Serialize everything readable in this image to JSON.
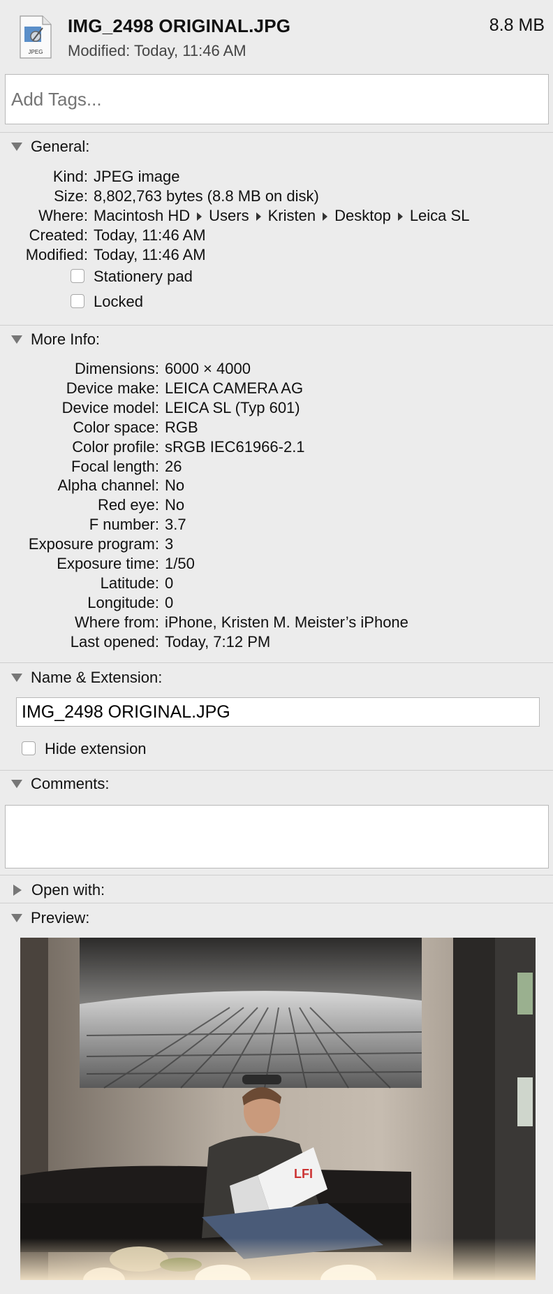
{
  "header": {
    "file_name": "IMG_2498 ORIGINAL.JPG",
    "file_size": "8.8 MB",
    "modified": "Modified: Today, 11:46 AM",
    "icon_label": "JPEG"
  },
  "tags": {
    "placeholder": "Add Tags..."
  },
  "general": {
    "title": "General:",
    "rows": [
      {
        "label": "Kind:",
        "value": "JPEG image"
      },
      {
        "label": "Size:",
        "value": "8,802,763 bytes (8.8 MB on disk)"
      },
      {
        "label": "Created:",
        "value": "Today, 11:46 AM"
      },
      {
        "label": "Modified:",
        "value": "Today, 11:46 AM"
      }
    ],
    "where_label": "Where:",
    "where_path": [
      "Macintosh HD",
      "Users",
      "Kristen",
      "Desktop",
      "Leica SL"
    ],
    "stationery_label": "Stationery pad",
    "locked_label": "Locked"
  },
  "more_info": {
    "title": "More Info:",
    "rows": [
      {
        "label": "Dimensions:",
        "value": "6000 × 4000"
      },
      {
        "label": "Device make:",
        "value": "LEICA CAMERA AG"
      },
      {
        "label": "Device model:",
        "value": "LEICA SL (Typ 601)"
      },
      {
        "label": "Color space:",
        "value": "RGB"
      },
      {
        "label": "Color profile:",
        "value": "sRGB IEC61966-2.1"
      },
      {
        "label": "Focal length:",
        "value": "26"
      },
      {
        "label": "Alpha channel:",
        "value": "No"
      },
      {
        "label": "Red eye:",
        "value": "No"
      },
      {
        "label": "F number:",
        "value": "3.7"
      },
      {
        "label": "Exposure program:",
        "value": "3"
      },
      {
        "label": "Exposure time:",
        "value": "1/50"
      },
      {
        "label": "Latitude:",
        "value": "0"
      },
      {
        "label": "Longitude:",
        "value": "0"
      },
      {
        "label": "Where from:",
        "value": "iPhone, Kristen M. Meister’s iPhone"
      },
      {
        "label": "Last opened:",
        "value": "Today, 7:12 PM"
      }
    ]
  },
  "name_ext": {
    "title": "Name & Extension:",
    "value": "IMG_2498 ORIGINAL.JPG",
    "hide_label": "Hide extension"
  },
  "comments": {
    "title": "Comments:"
  },
  "open_with": {
    "title": "Open with:"
  },
  "preview": {
    "title": "Preview:",
    "magazine_text": "LFI"
  }
}
